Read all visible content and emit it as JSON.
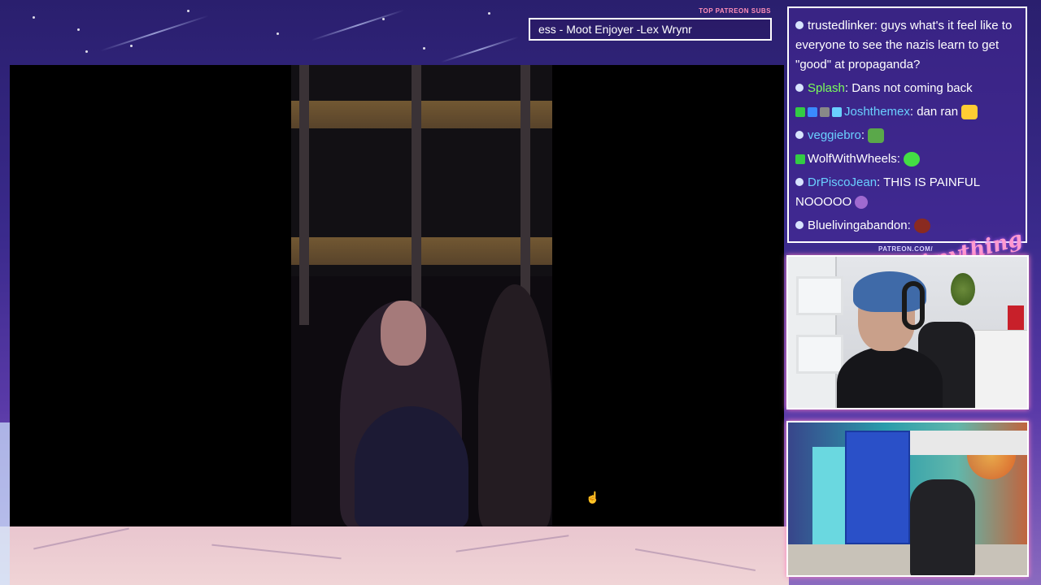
{
  "overlay": {
    "subs_label": "TOP PATREON SUBS",
    "subs_ticker": "ess - Moot Enjoyer -Lex Wrynr",
    "patreon_label": "PATREON.COM/",
    "brand_logo": "Anything Else?"
  },
  "chat": {
    "messages": [
      {
        "user": "trustedlinker",
        "user_color": "#ffffff",
        "text": "guys what's it feel like to everyone to see the nazis learn to get \"good\" at propaganda?",
        "badges": [],
        "emote": null
      },
      {
        "user": "Splash",
        "user_color": "#7cff5a",
        "text": "Dans not coming back",
        "badges": [],
        "emote": null
      },
      {
        "user": "Joshthemex",
        "user_color": "#6ad0ff",
        "text": "dan ran",
        "badges": [
          "green-k-badge",
          "blue-badge",
          "gray-badge",
          "stack-badge"
        ],
        "emote": "yellow-emote"
      },
      {
        "user": "veggiebro",
        "user_color": "#6ad0ff",
        "text": "",
        "badges": [],
        "emote": "pepe-emote"
      },
      {
        "user": "WolfWithWheels",
        "user_color": "#ffffff",
        "text": "",
        "badges": [
          "green-k-badge"
        ],
        "emote": "green-emote"
      },
      {
        "user": "DrPiscoJean",
        "user_color": "#6ad0ff",
        "text": "THIS IS PAINFUL NOOOOO",
        "badges": [],
        "emote": "purple-emote"
      },
      {
        "user": "Bluelivingabandon",
        "user_color": "#ffffff",
        "text": "",
        "badges": [],
        "emote": "red-emote"
      }
    ]
  },
  "colors": {
    "bg": "#2a1f6e",
    "chat_border": "#ffffff",
    "accent_pink": "#ff80c0"
  }
}
